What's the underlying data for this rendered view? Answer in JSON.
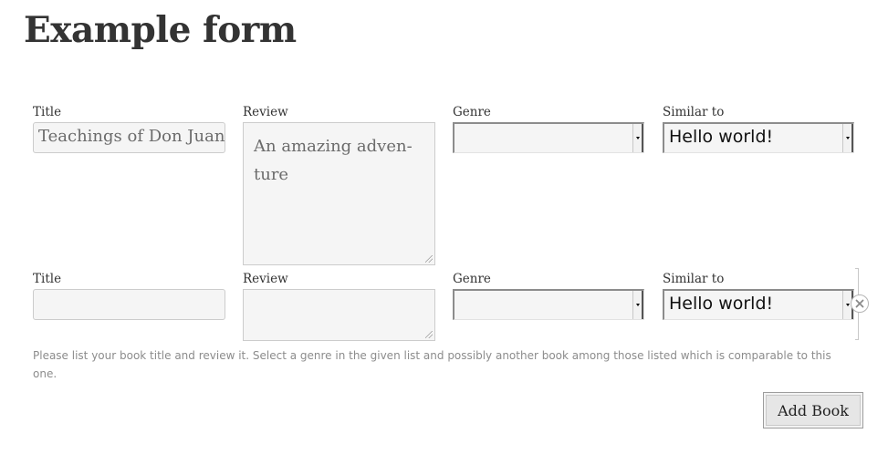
{
  "page": {
    "title": "Example form"
  },
  "rows": [
    {
      "title_label": "Title",
      "title_value": "Teachings of Don Juan",
      "review_label": "Review",
      "review_value": "An amazing adven-ture",
      "review_line1": "An amazing adven-",
      "review_line2": "ture",
      "genre_label": "Genre",
      "genre_value": "",
      "similar_label": "Similar to",
      "similar_value": "Hello world!"
    },
    {
      "title_label": "Title",
      "title_value": "",
      "review_label": "Review",
      "review_value": "",
      "genre_label": "Genre",
      "genre_value": "",
      "similar_label": "Similar to",
      "similar_value": "Hello world!"
    }
  ],
  "help_text": "Please list your book title and review it. Select a genre in the given list and possibly another book among those listed which is comparable to this one.",
  "actions": {
    "add_label": "Add Book"
  },
  "icons": {
    "remove_row": "close-circle-icon",
    "select_arrow": "chevron-down-icon",
    "resize_grip": "resize-grip-icon"
  },
  "colors": {
    "field_background": "#f5f5f5",
    "field_border": "#cccccc",
    "title_text": "#333333",
    "help_text": "#8c8c8c",
    "button_background": "#e6e6e6"
  }
}
